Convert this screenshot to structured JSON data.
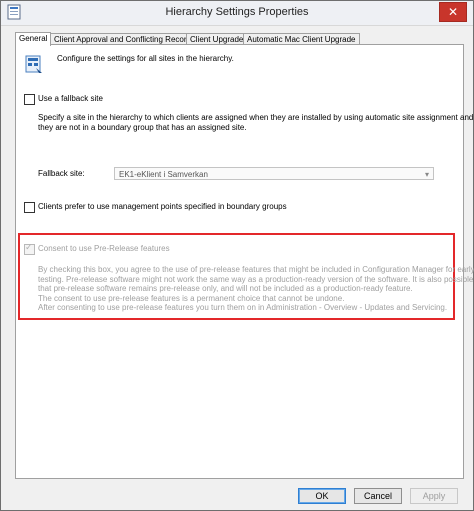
{
  "window": {
    "title": "Hierarchy Settings Properties",
    "close_glyph": "✕"
  },
  "tabs": [
    {
      "label": "General"
    },
    {
      "label": "Client Approval and Conflicting Records"
    },
    {
      "label": "Client Upgrade"
    },
    {
      "label": "Automatic Mac Client Upgrade"
    }
  ],
  "general": {
    "intro_icon": "hierarchy-settings-icon",
    "intro": "Configure the settings for all sites in the hierarchy.",
    "fallback": {
      "checkbox_label": "Use a fallback site",
      "checked": false,
      "description_line1": "Specify a site in the hierarchy to which clients are assigned when they are installed by using automatic site assignment and",
      "description_line2": "they are not in a boundary group that has an assigned site.",
      "site_label": "Fallback site:",
      "site_value": "EK1-eKlient i Samverkan"
    },
    "prefer_mp": {
      "label": "Clients prefer to use management points specified in boundary groups",
      "checked": false
    },
    "prerelease": {
      "label": "Consent to use Pre-Release features",
      "checked": true,
      "lines": [
        "By checking this box, you agree to the use of pre-release features that might be included in Configuration Manager for early",
        "testing. Pre-release software might not work the same way as a production-ready version of the software. It is also possible",
        "that pre-release software remains pre-release only, and will not be included as a production-ready feature.",
        "The consent to use pre-release features is a permanent choice that cannot be undone.",
        "After consenting to use pre-release features you turn them on in Administration - Overview - Updates and Servicing."
      ]
    }
  },
  "buttons": {
    "ok": "OK",
    "cancel": "Cancel",
    "apply": "Apply"
  },
  "colors": {
    "highlight": "#e3282a",
    "close": "#c8352b"
  }
}
